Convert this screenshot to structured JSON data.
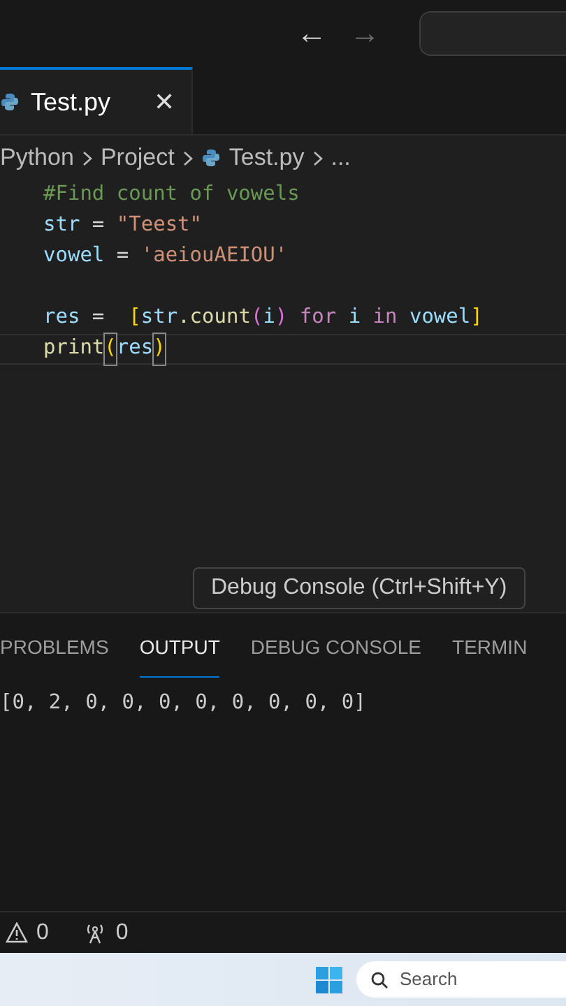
{
  "title_bar": {
    "nav": [
      {
        "label": "←",
        "disabled": false
      },
      {
        "label": "→",
        "disabled": true
      }
    ]
  },
  "tabs": [
    {
      "label": "Test.py",
      "selected": true,
      "close": "✕"
    }
  ],
  "breadcrumb": [
    {
      "label": "Python",
      "kind": "folder"
    },
    {
      "label": "Project",
      "kind": "folder"
    },
    {
      "label": "Test.py",
      "kind": "file"
    },
    {
      "label": "...",
      "kind": "more"
    }
  ],
  "code_lines": [
    {
      "current": false,
      "tokens": [
        {
          "text": "#Find count of vowels",
          "kind": "comment"
        }
      ]
    },
    {
      "current": false,
      "tokens": [
        {
          "text": "str",
          "kind": "var"
        },
        {
          "text": " = ",
          "kind": "op"
        },
        {
          "text": "\"Teest\"",
          "kind": "string"
        }
      ]
    },
    {
      "current": false,
      "tokens": [
        {
          "text": "vowel",
          "kind": "var"
        },
        {
          "text": " = ",
          "kind": "op"
        },
        {
          "text": "'aeiouAEIOU'",
          "kind": "string"
        }
      ]
    },
    {
      "current": false
    },
    {
      "current": false,
      "tokens": [
        {
          "text": "res",
          "kind": "var"
        },
        {
          "text": " =  ",
          "kind": "op"
        },
        {
          "text": "[",
          "kind": "bracket"
        },
        {
          "text": "str",
          "kind": "var"
        },
        {
          "text": ".count",
          "kind": "func"
        },
        {
          "text": "(",
          "kind": "paren"
        },
        {
          "text": "i",
          "kind": "var"
        },
        {
          "text": ")",
          "kind": "paren"
        },
        {
          "text": " for ",
          "kind": "keyword"
        },
        {
          "text": "i",
          "kind": "var"
        },
        {
          "text": " in ",
          "kind": "keyword"
        },
        {
          "text": "vowel",
          "kind": "var"
        },
        {
          "text": "]",
          "kind": "bracket"
        }
      ]
    },
    {
      "current": true,
      "tokens": [
        {
          "text": "print",
          "kind": "func"
        },
        {
          "text": "(",
          "kind": "match"
        },
        {
          "text": "res",
          "kind": "var"
        },
        {
          "text": ")",
          "kind": "match"
        }
      ]
    }
  ],
  "tooltip": "Debug Console (Ctrl+Shift+Y)",
  "panel_tabs": [
    {
      "label": "PROBLEMS",
      "selected": false
    },
    {
      "label": "OUTPUT",
      "selected": true
    },
    {
      "label": "DEBUG CONSOLE",
      "selected": false
    },
    {
      "label": "TERMIN",
      "selected": false
    }
  ],
  "output": "[0, 2, 0, 0, 0, 0, 0, 0, 0, 0]",
  "status_bar": [
    {
      "kind": "warnings",
      "label": "0"
    },
    {
      "kind": "ports",
      "label": "0"
    }
  ],
  "taskbar": {
    "search_placeholder": "Search"
  }
}
